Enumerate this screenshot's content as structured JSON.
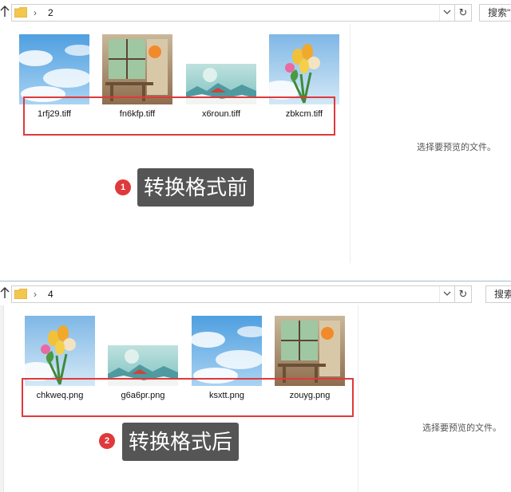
{
  "top_window": {
    "path_segment": "2",
    "separator": "›",
    "search_placeholder": "搜索\"",
    "files": [
      {
        "name": "1rfj29.tiff",
        "image": "sky-clouds"
      },
      {
        "name": "fn6kfp.tiff",
        "image": "cafe-window"
      },
      {
        "name": "x6roun.tiff",
        "image": "teal-landscape"
      },
      {
        "name": "zbkcm.tiff",
        "image": "tulip-bouquet"
      }
    ],
    "preview_hint": "选择要预览的文件。",
    "badge_number": "1",
    "caption": "转换格式前"
  },
  "bottom_window": {
    "path_segment": "4",
    "separator": "›",
    "search_placeholder": "搜索",
    "files": [
      {
        "name": "chkweq.png",
        "image": "tulip-bouquet"
      },
      {
        "name": "g6a6pr.png",
        "image": "teal-landscape"
      },
      {
        "name": "ksxtt.png",
        "image": "sky-clouds"
      },
      {
        "name": "zouyg.png",
        "image": "cafe-window"
      }
    ],
    "preview_hint": "选择要预览的文件。",
    "badge_number": "2",
    "caption": "转换格式后"
  },
  "icons": {
    "back": "up-arrow-icon",
    "folder": "folder-icon",
    "dropdown": "chevron-down-icon",
    "refresh": "refresh-icon"
  },
  "colors": {
    "annotation_red": "#e0393b",
    "caption_bg": "#555555",
    "folder_yellow": "#f3c64e"
  }
}
